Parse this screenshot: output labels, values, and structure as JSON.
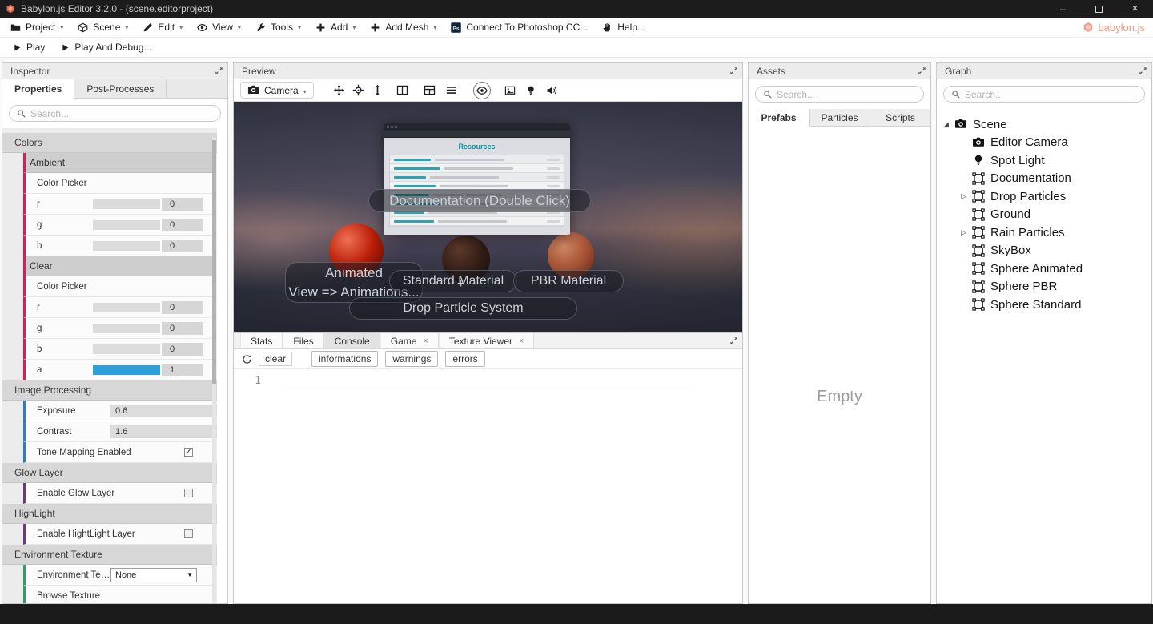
{
  "colors": {
    "accent_crimson": "#e2175b",
    "accent_blue": "#2e7fc2",
    "accent_purple": "#6e3a7c",
    "accent_green": "#2f9e63",
    "slider_fill": "#2e9fd8",
    "logo_orange": "#e0684b"
  },
  "title_bar": {
    "title": "Babylon.js Editor 3.2.0 - (scene.editorproject)",
    "controls": [
      "minimize",
      "maximize",
      "close"
    ]
  },
  "menu": {
    "logo_text": "babylon.js",
    "items": [
      {
        "label": "Project",
        "icon": "folder",
        "caret": true
      },
      {
        "label": "Scene",
        "icon": "scene",
        "caret": true
      },
      {
        "label": "Edit",
        "icon": "edit",
        "caret": true
      },
      {
        "label": "View",
        "icon": "eye",
        "caret": true
      },
      {
        "label": "Tools",
        "icon": "tools",
        "caret": true
      },
      {
        "label": "Add",
        "icon": "plus",
        "caret": true
      },
      {
        "label": "Add Mesh",
        "icon": "plus",
        "caret": true
      },
      {
        "label": "Connect To Photoshop CC...",
        "icon": "photoshop",
        "caret": false
      },
      {
        "label": "Help...",
        "icon": "help",
        "caret": false
      }
    ]
  },
  "play_bar": {
    "play": "Play",
    "play_debug": "Play And Debug..."
  },
  "inspector": {
    "title": "Inspector",
    "tabs": [
      "Properties",
      "Post-Processes"
    ],
    "active_tab": "Properties",
    "search_placeholder": "Search...",
    "rows": [
      {
        "type": "section",
        "label": "Colors"
      },
      {
        "type": "subheader",
        "label": "Ambient",
        "accent": "crimson"
      },
      {
        "type": "text",
        "label": "Color Picker",
        "accent": "crimson"
      },
      {
        "type": "slider",
        "label": "r",
        "value": "0",
        "fill": 0,
        "accent": "crimson"
      },
      {
        "type": "slider",
        "label": "g",
        "value": "0",
        "fill": 0,
        "accent": "crimson"
      },
      {
        "type": "slider",
        "label": "b",
        "value": "0",
        "fill": 0,
        "accent": "crimson"
      },
      {
        "type": "subheader",
        "label": "Clear",
        "accent": "crimson"
      },
      {
        "type": "text",
        "label": "Color Picker",
        "accent": "crimson"
      },
      {
        "type": "slider",
        "label": "r",
        "value": "0",
        "fill": 0,
        "accent": "crimson"
      },
      {
        "type": "slider",
        "label": "g",
        "value": "0",
        "fill": 0,
        "accent": "crimson"
      },
      {
        "type": "slider",
        "label": "b",
        "value": "0",
        "fill": 0,
        "accent": "crimson"
      },
      {
        "type": "slider",
        "label": "a",
        "value": "1",
        "fill": 100,
        "accent": "crimson"
      },
      {
        "type": "section",
        "label": "Image Processing"
      },
      {
        "type": "valuebar",
        "label": "Exposure",
        "value": "0.6",
        "accent": "blue"
      },
      {
        "type": "valuebar",
        "label": "Contrast",
        "value": "1.6",
        "accent": "blue"
      },
      {
        "type": "checkbox",
        "label": "Tone Mapping Enabled",
        "checked": true,
        "accent": "blue"
      },
      {
        "type": "section",
        "label": "Glow Layer"
      },
      {
        "type": "checkbox",
        "label": "Enable Glow Layer",
        "checked": false,
        "accent": "purple"
      },
      {
        "type": "section",
        "label": "HighLight"
      },
      {
        "type": "checkbox",
        "label": "Enable HightLight Layer",
        "checked": false,
        "accent": "purple"
      },
      {
        "type": "section",
        "label": "Environment Texture"
      },
      {
        "type": "dropdown",
        "label": "Environment Textu...",
        "value": "None",
        "accent": "green"
      },
      {
        "type": "text",
        "label": "Browse Texture",
        "accent": "green"
      }
    ]
  },
  "preview": {
    "title": "Preview",
    "camera_label": "Camera",
    "tool_buttons": [
      {
        "name": "move-tool-button",
        "icon": "move"
      },
      {
        "name": "rotate-tool-button",
        "icon": "rotate"
      },
      {
        "name": "scale-tool-button",
        "icon": "scale"
      },
      {
        "name": "split-vertical-button",
        "icon": "splitv"
      },
      {
        "name": "split-horizontal-button",
        "icon": "splith"
      },
      {
        "name": "layout-rows-button",
        "icon": "rows"
      }
    ],
    "toggle_buttons": [
      {
        "name": "visibility-toggle-button",
        "icon": "eye",
        "round": true
      },
      {
        "name": "textures-toggle-button",
        "icon": "image"
      },
      {
        "name": "lights-toggle-button",
        "icon": "bulb"
      },
      {
        "name": "audio-toggle-button",
        "icon": "speaker"
      }
    ]
  },
  "viewport": {
    "doc_window": {
      "heading": "Resources"
    },
    "labels": {
      "documentation": "Documentation (Double Click)",
      "animated_line1": "Animated",
      "animated_line2": "View => Animations...",
      "standard": "Standard Material",
      "pbr": "PBR Material",
      "drop_particles": "Drop Particle System"
    }
  },
  "console": {
    "tabs": [
      {
        "label": "Stats"
      },
      {
        "label": "Files"
      },
      {
        "label": "Console",
        "active": true
      },
      {
        "label": "Game",
        "closable": true
      },
      {
        "label": "Texture Viewer",
        "closable": true
      }
    ],
    "clear_label": "clear",
    "filters": [
      "informations",
      "warnings",
      "errors"
    ],
    "line_number": "1"
  },
  "assets": {
    "title": "Assets",
    "search_placeholder": "Search...",
    "tabs": [
      "Prefabs",
      "Particles",
      "Scripts"
    ],
    "active_tab": "Prefabs",
    "empty_text": "Empty"
  },
  "graph": {
    "title": "Graph",
    "search_placeholder": "Search...",
    "root": {
      "label": "Scene",
      "icon": "camera"
    },
    "items": [
      {
        "label": "Editor Camera",
        "icon": "camera"
      },
      {
        "label": "Spot Light",
        "icon": "bulb"
      },
      {
        "label": "Documentation",
        "icon": "mesh"
      },
      {
        "label": "Drop Particles",
        "icon": "mesh",
        "caret": true
      },
      {
        "label": "Ground",
        "icon": "mesh"
      },
      {
        "label": "Rain Particles",
        "icon": "mesh",
        "caret": true
      },
      {
        "label": "SkyBox",
        "icon": "mesh"
      },
      {
        "label": "Sphere Animated",
        "icon": "mesh"
      },
      {
        "label": "Sphere PBR",
        "icon": "mesh"
      },
      {
        "label": "Sphere Standard",
        "icon": "mesh"
      }
    ]
  }
}
